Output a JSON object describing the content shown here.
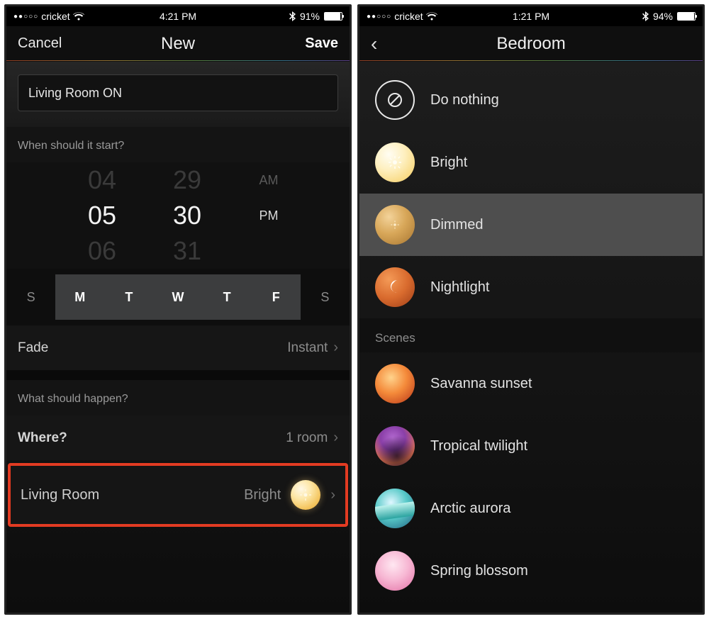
{
  "screen1": {
    "status": {
      "carrier": "cricket",
      "time": "4:21 PM",
      "battery_pct": "91%",
      "battery_fill": 91
    },
    "nav": {
      "left": "Cancel",
      "title": "New",
      "right": "Save"
    },
    "name_value": "Living Room ON",
    "section_when": "When should it start?",
    "picker": {
      "hour_prev": "04",
      "hour": "05",
      "hour_next": "06",
      "min_prev": "29",
      "min": "30",
      "min_next": "31",
      "am": "AM",
      "pm": "PM"
    },
    "days": [
      "S",
      "M",
      "T",
      "W",
      "T",
      "F",
      "S"
    ],
    "days_selected": [
      false,
      true,
      true,
      true,
      true,
      true,
      false
    ],
    "fade_label": "Fade",
    "fade_value": "Instant",
    "section_what": "What should happen?",
    "where_label": "Where?",
    "where_value": "1 room",
    "room_name": "Living Room",
    "room_scene": "Bright"
  },
  "screen2": {
    "status": {
      "carrier": "cricket",
      "time": "1:21 PM",
      "battery_pct": "94%",
      "battery_fill": 94
    },
    "nav": {
      "title": "Bedroom"
    },
    "presets": [
      {
        "label": "Do nothing",
        "orb": "nothing",
        "selected": false
      },
      {
        "label": "Bright",
        "orb": "bright",
        "selected": false
      },
      {
        "label": "Dimmed",
        "orb": "dimmed",
        "selected": true
      },
      {
        "label": "Nightlight",
        "orb": "night",
        "selected": false
      }
    ],
    "scenes_header": "Scenes",
    "scenes": [
      {
        "label": "Savanna sunset",
        "orb": "savanna"
      },
      {
        "label": "Tropical twilight",
        "orb": "tropical"
      },
      {
        "label": "Arctic aurora",
        "orb": "arctic"
      },
      {
        "label": "Spring blossom",
        "orb": "spring"
      }
    ]
  }
}
